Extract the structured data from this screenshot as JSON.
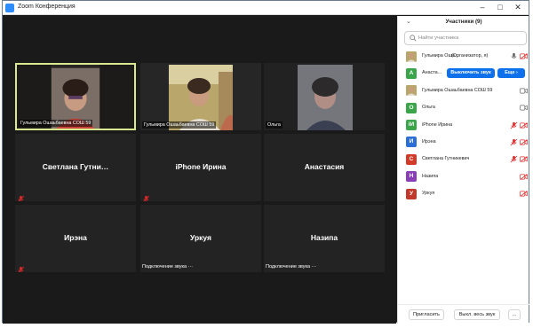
{
  "window": {
    "title": "Zoom Конференция"
  },
  "colors": {
    "accent": "#0e71eb",
    "active_border": "#d9e88e",
    "muted_red": "#e02828"
  },
  "tiles": [
    {
      "name": "Гульмира Ошаьбаевна СОШ 59",
      "type": "video",
      "active": true
    },
    {
      "name": "Гульмира Ошаьбаевна СОШ 59",
      "type": "video",
      "active": false
    },
    {
      "name": "Ольга",
      "type": "video",
      "active": false
    },
    {
      "center_name": "Светлана  Гутни…",
      "muted": true
    },
    {
      "center_name": "iPhone Ирина",
      "muted": true
    },
    {
      "center_name": "Анастасия",
      "muted": false
    },
    {
      "center_name": "Ирэна",
      "muted": true
    },
    {
      "center_name": "Уркуя",
      "status": "Подключение звука ⋯"
    },
    {
      "center_name": "Назипа",
      "status": "Подключение звука ⋯"
    }
  ],
  "panel": {
    "title": "Участники (9)",
    "collapse_icon": "chevron-down-icon",
    "search_placeholder": "Найти участника",
    "participants": [
      {
        "initial": "",
        "color": "#8a6f5a",
        "name": "Гульмира Оша...",
        "extra": "(Организатор, я)",
        "mic": "on",
        "cam": "off"
      },
      {
        "initial": "А",
        "color": "#3aa54a",
        "name": "Анаста...",
        "unmute_label": "Выключить звук",
        "more_label": "Еще ›"
      },
      {
        "initial": "",
        "color": "#8a6f5a",
        "name": "Гульмира Ошаьбаевна СОШ 59",
        "mic": "none",
        "cam": "on"
      },
      {
        "initial": "О",
        "color": "#3aa54a",
        "name": "Ольга",
        "mic": "none",
        "cam": "on"
      },
      {
        "initial": "iИ",
        "color": "#3aa54a",
        "name": "iPhone Ирина",
        "mic": "muted",
        "cam": "off"
      },
      {
        "initial": "И",
        "color": "#2d6fd8",
        "name": "Ирэна",
        "mic": "muted",
        "cam": "off"
      },
      {
        "initial": "С",
        "color": "#d23a2a",
        "name": "Светлана Гутникевич",
        "mic": "muted",
        "cam": "off"
      },
      {
        "initial": "Н",
        "color": "#8a3fb8",
        "name": "Назипа",
        "mic": "none",
        "cam": "off"
      },
      {
        "initial": "У",
        "color": "#c0392b",
        "name": "Уркуя",
        "mic": "none",
        "cam": "off"
      }
    ],
    "footer": {
      "invite": "Пригласить",
      "mute_all": "Выкл. весь звук",
      "more": "..."
    }
  }
}
